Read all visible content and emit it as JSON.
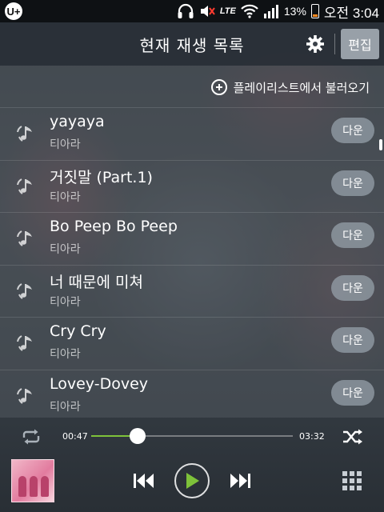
{
  "status_bar": {
    "carrier": "U+",
    "network": "LTE",
    "battery": "13%",
    "time": "오전 3:04"
  },
  "header": {
    "title": "현재 재생 목록",
    "edit_label": "편집"
  },
  "load_playlist_label": "플레이리스트에서 불러오기",
  "songs": [
    {
      "title": "yayaya",
      "artist": "티아라",
      "download_label": "다운"
    },
    {
      "title": "거짓말 (Part.1)",
      "artist": "티아라",
      "download_label": "다운"
    },
    {
      "title": "Bo Peep Bo Peep",
      "artist": "티아라",
      "download_label": "다운"
    },
    {
      "title": "너 때문에 미쳐",
      "artist": "티아라",
      "download_label": "다운"
    },
    {
      "title": "Cry Cry",
      "artist": "티아라",
      "download_label": "다운"
    },
    {
      "title": "Lovey-Dovey",
      "artist": "티아라",
      "download_label": "다운"
    }
  ],
  "player": {
    "elapsed": "00:47",
    "total": "03:32",
    "progress": 0.231,
    "accent_color": "#7ec23a"
  },
  "icons": {
    "headphones": "headphones-icon",
    "mute": "volume-mute-icon",
    "wifi": "wifi-icon",
    "signal": "signal-icon",
    "settings": "gear-icon",
    "add": "plus-circle-icon",
    "music_note": "music-note-icon",
    "repeat": "repeat-icon",
    "shuffle": "shuffle-icon",
    "previous": "previous-icon",
    "play": "play-icon",
    "next": "next-icon",
    "menu": "grid-menu-icon"
  }
}
